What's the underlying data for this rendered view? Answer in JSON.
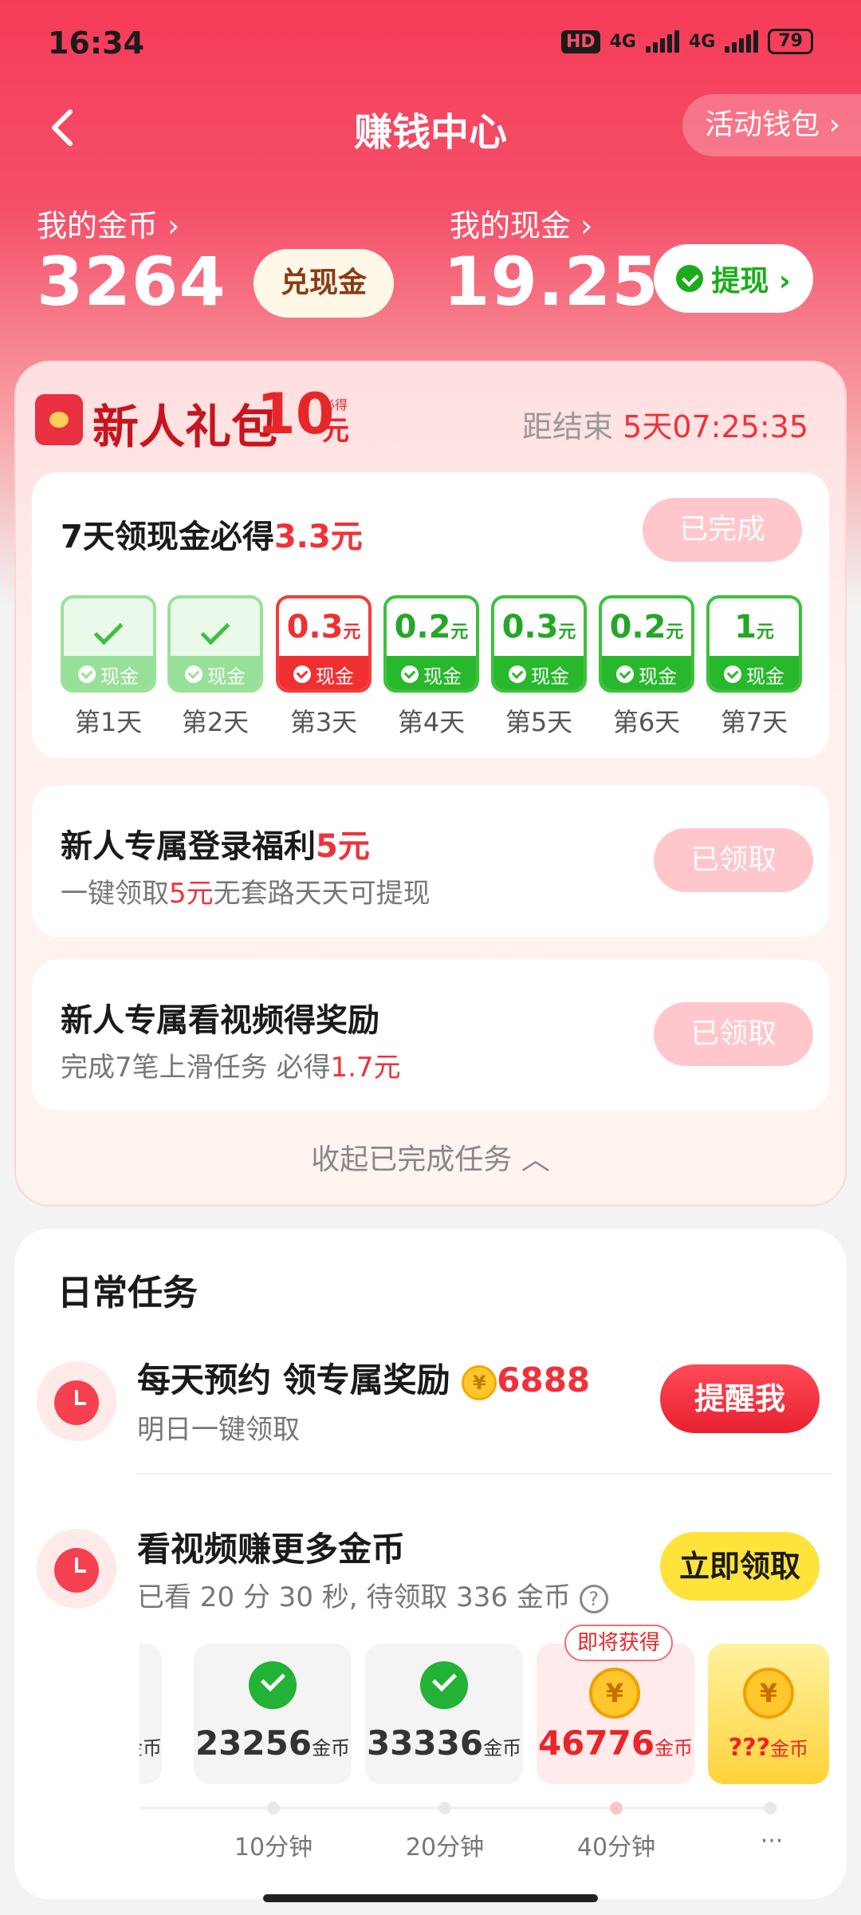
{
  "status": {
    "time": "16:34",
    "hd": "HD",
    "net1": "4G",
    "net2": "4G",
    "battery": "79"
  },
  "nav": {
    "title": "赚钱中心",
    "wallet": "活动钱包 ›",
    "back_icon": "chevron-left-icon"
  },
  "account": {
    "coins_label": "我的金币 ›",
    "coins": "3264",
    "exchange": "兑现金",
    "cash_label": "我的现金 ›",
    "cash": "19.25",
    "withdraw": "提现 ›"
  },
  "gift": {
    "title": "新人礼包",
    "amount": "10",
    "unit": "元",
    "must": "必得",
    "countdown_label": "距结束",
    "countdown": "5天07:25:35"
  },
  "seven_day": {
    "title_pre": "7天领现金必得",
    "title_amt": "3.3元",
    "status": "已完成",
    "days": [
      {
        "label": "第1天",
        "value": "",
        "tag": "现金",
        "state": "past"
      },
      {
        "label": "第2天",
        "value": "",
        "tag": "现金",
        "state": "past"
      },
      {
        "label": "第3天",
        "value": "0.3",
        "unit": "元",
        "tag": "现金",
        "state": "today"
      },
      {
        "label": "第4天",
        "value": "0.2",
        "unit": "元",
        "tag": "现金",
        "state": "future"
      },
      {
        "label": "第5天",
        "value": "0.3",
        "unit": "元",
        "tag": "现金",
        "state": "future"
      },
      {
        "label": "第6天",
        "value": "0.2",
        "unit": "元",
        "tag": "现金",
        "state": "future"
      },
      {
        "label": "第7天",
        "value": "1",
        "unit": "元",
        "tag": "现金",
        "state": "future"
      }
    ]
  },
  "login_bonus": {
    "title_pre": "新人专属登录福利",
    "title_amt": "5元",
    "desc_pre": "一键领取",
    "desc_amt": "5元",
    "desc_post": "无套路天天可提现",
    "status": "已领取"
  },
  "video_bonus": {
    "title": "新人专属看视频得奖励",
    "desc_pre": "完成7笔上滑任务 必得",
    "desc_amt": "1.7元",
    "status": "已领取"
  },
  "collapse": "收起已完成任务 ︿",
  "daily": {
    "title": "日常任务",
    "task1": {
      "title": "每天预约 领专属奖励",
      "coin_icon": "¥",
      "reward": "6888",
      "desc": "明日一键领取",
      "button": "提醒我"
    },
    "task2": {
      "title": "看视频赚更多金币",
      "desc": "已看 20 分 30 秒, 待领取 336 金币",
      "help": "?",
      "button": "立即领取"
    },
    "rewards": [
      {
        "value": "",
        "unit": "金币",
        "state": "clipped"
      },
      {
        "value": "23256",
        "unit": "金币",
        "state": "done"
      },
      {
        "value": "33336",
        "unit": "金币",
        "state": "done"
      },
      {
        "value": "46776",
        "unit": "金币",
        "state": "next"
      },
      {
        "value": "???",
        "unit": "金币",
        "state": "mystery"
      }
    ],
    "soon_label": "即将获得",
    "times": [
      "10分钟",
      "20分钟",
      "40分钟",
      "···"
    ]
  },
  "colors": {
    "brand": "#f53b58",
    "green": "#27b82b",
    "red": "#f0313a",
    "yellow": "#ffe23a"
  }
}
